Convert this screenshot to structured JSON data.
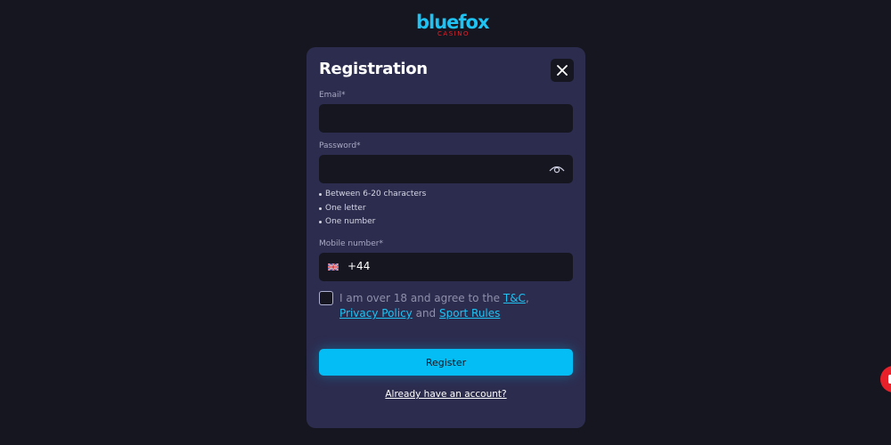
{
  "brand": {
    "logo_main": "bluefox",
    "logo_sub": "CASINO",
    "accent_color": "#1ec2f3",
    "logo_sub_color": "#e8202a"
  },
  "modal": {
    "title": "Registration",
    "close_icon": "close-icon"
  },
  "form": {
    "email": {
      "label": "Email*",
      "value": "",
      "placeholder": ""
    },
    "password": {
      "label": "Password*",
      "value": "",
      "toggle_icon": "eye-icon",
      "rules": [
        "Between 6-20 characters",
        "One letter",
        "One number"
      ]
    },
    "mobile": {
      "label": "Mobile number*",
      "flag_icon": "uk-flag-icon",
      "dial_code": "+44",
      "value": ""
    },
    "agreement": {
      "checked": false,
      "text_1": "I am over 18 and agree to the ",
      "link_tc": "T&C",
      "sep_1": ", ",
      "link_privacy": "Privacy Policy",
      "text_2": " and ",
      "link_sport": "Sport Rules"
    },
    "register_label": "Register",
    "login_link": "Already have an account?"
  },
  "colors": {
    "background": "#15161f",
    "modal": "#2c2c4e",
    "button": "#05bdf5",
    "chat_bubble": "#e8202a"
  },
  "chat_widget_icon": "chat-bubble-icon"
}
